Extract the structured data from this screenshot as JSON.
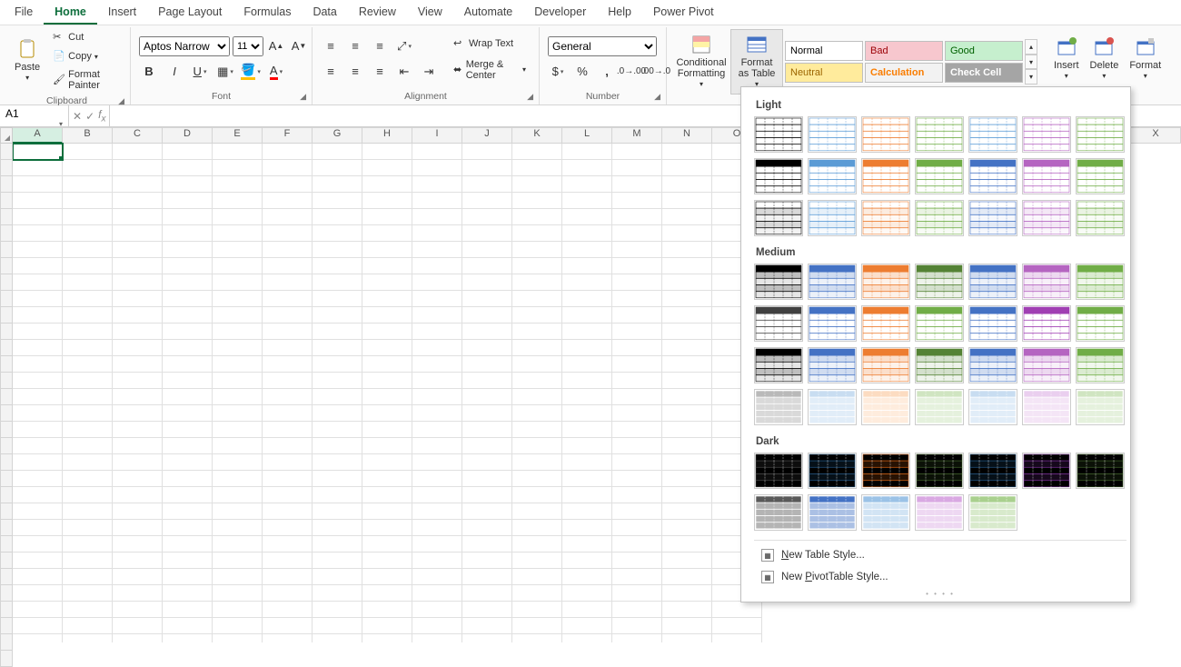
{
  "tabs": [
    "File",
    "Home",
    "Insert",
    "Page Layout",
    "Formulas",
    "Data",
    "Review",
    "View",
    "Automate",
    "Developer",
    "Help",
    "Power Pivot"
  ],
  "active_tab": "Home",
  "clipboard": {
    "paste": "Paste",
    "cut": "Cut",
    "copy": "Copy",
    "format_painter": "Format Painter",
    "group": "Clipboard"
  },
  "font": {
    "family": "Aptos Narrow",
    "size": "11",
    "group": "Font"
  },
  "alignment": {
    "wrap": "Wrap Text",
    "merge": "Merge & Center",
    "group": "Alignment"
  },
  "number": {
    "format": "General",
    "group": "Number"
  },
  "styles": {
    "cond": "Conditional Formatting",
    "fat": "Format as Table",
    "cells": {
      "normal": {
        "label": "Normal",
        "bg": "#ffffff",
        "fg": "#000000"
      },
      "bad": {
        "label": "Bad",
        "bg": "#f7c7ce",
        "fg": "#9c0006"
      },
      "good": {
        "label": "Good",
        "bg": "#c6efce",
        "fg": "#006100"
      },
      "neutral": {
        "label": "Neutral",
        "bg": "#ffeb9c",
        "fg": "#9c6500"
      },
      "calc": {
        "label": "Calculation",
        "bg": "#f2f2f2",
        "fg": "#fa7d00"
      },
      "check": {
        "label": "Check Cell",
        "bg": "#a5a5a5",
        "fg": "#ffffff"
      }
    }
  },
  "cells": {
    "insert": "Insert",
    "delete": "Delete",
    "format": "Format"
  },
  "namebox": "A1",
  "columns": [
    "A",
    "B",
    "C",
    "D",
    "E",
    "F",
    "G",
    "H",
    "I",
    "J",
    "K",
    "L",
    "M",
    "N",
    "O",
    "X"
  ],
  "total_rows": 32,
  "selected_cell": "A1",
  "table_styles": {
    "sections": [
      {
        "title": "Light",
        "rows": 3,
        "palettes": [
          [
            "#000000",
            "#5b9bd5",
            "#ed7d31",
            "#70ad47",
            "#5b9bd5",
            "#b565c1",
            "#70ad47"
          ],
          [
            "#000000",
            "#5b9bd5",
            "#ed7d31",
            "#70ad47",
            "#4472c4",
            "#b565c1",
            "#70ad47"
          ],
          [
            "#000000",
            "#5b9bd5",
            "#ed7d31",
            "#70ad47",
            "#4472c4",
            "#b565c1",
            "#70ad47"
          ]
        ],
        "variant": "light"
      },
      {
        "title": "Medium",
        "rows": 4,
        "palettes": [
          [
            "#000000",
            "#4472c4",
            "#ed7d31",
            "#548235",
            "#4472c4",
            "#b565c1",
            "#70ad47"
          ],
          [
            "#404040",
            "#4472c4",
            "#ed7d31",
            "#70ad47",
            "#4472c4",
            "#a03fb3",
            "#70ad47"
          ],
          [
            "#000000",
            "#4472c4",
            "#ed7d31",
            "#548235",
            "#4472c4",
            "#b565c1",
            "#70ad47"
          ],
          [
            "#808080",
            "#9bc2e6",
            "#fabf8f",
            "#a9d08e",
            "#9bc2e6",
            "#d9a8e2",
            "#a9d08e"
          ]
        ],
        "variant": "medium"
      },
      {
        "title": "Dark",
        "rows": 2,
        "palettes": [
          [
            "#404040",
            "#1f4e78",
            "#c55a11",
            "#375623",
            "#1f4e78",
            "#702a8c",
            "#375623"
          ],
          [
            "#595959",
            "#4472c4",
            "#9bc2e6",
            "#d9a8e2",
            "#a9d08e",
            "",
            ""
          ]
        ],
        "variant": "dark"
      }
    ],
    "new_style": "New Table Style...",
    "new_pivot": "New PivotTable Style..."
  }
}
